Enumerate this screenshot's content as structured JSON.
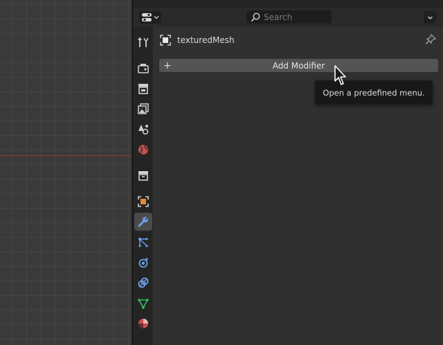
{
  "header": {
    "search_placeholder": "Search"
  },
  "sidebar": {
    "tabs": [
      {
        "name": "tool",
        "icon": "tool-icon"
      },
      {
        "name": "render",
        "icon": "render-icon"
      },
      {
        "name": "output",
        "icon": "output-icon"
      },
      {
        "name": "view-layer",
        "icon": "view-layer-icon"
      },
      {
        "name": "scene",
        "icon": "scene-icon"
      },
      {
        "name": "world",
        "icon": "world-icon"
      },
      {
        "name": "collection",
        "icon": "collection-icon"
      },
      {
        "name": "object",
        "icon": "object-icon"
      },
      {
        "name": "modifiers",
        "icon": "wrench-icon",
        "active": true
      },
      {
        "name": "particles",
        "icon": "particles-icon"
      },
      {
        "name": "physics",
        "icon": "physics-icon"
      },
      {
        "name": "constraints",
        "icon": "constraints-icon"
      },
      {
        "name": "data",
        "icon": "mesh-data-icon"
      },
      {
        "name": "material",
        "icon": "material-icon"
      }
    ]
  },
  "content": {
    "object_name": "texturedMesh",
    "add_modifier_label": "Add Modifier",
    "tooltip": "Open a predefined menu."
  },
  "colors": {
    "active_tab": "#4b4b4b",
    "wrench": "#6aa0e8",
    "object_orange": "#e08a3c",
    "mesh_green": "#32c060",
    "world_red": "#c05050"
  }
}
